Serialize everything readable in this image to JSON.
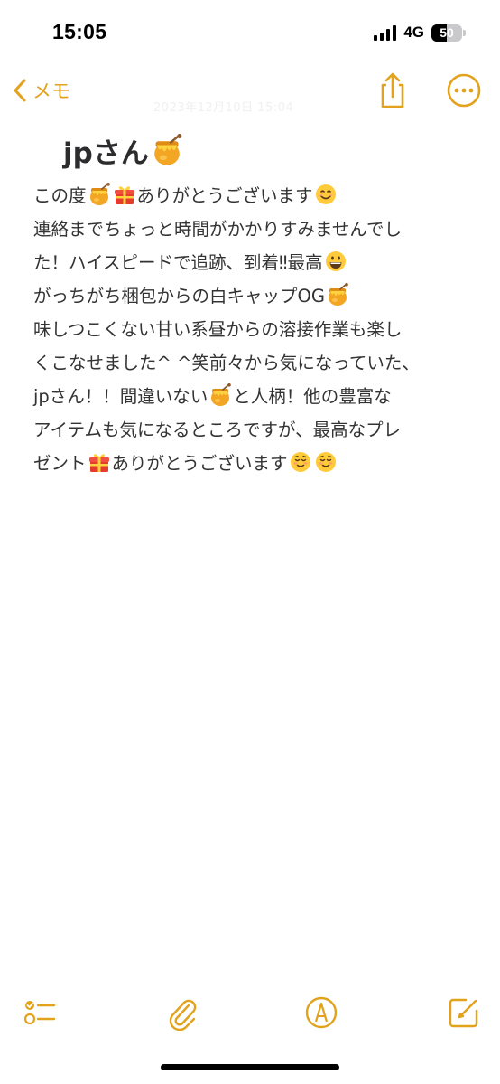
{
  "status_bar": {
    "time": "15:05",
    "network": "4G",
    "battery_level": "50",
    "battery_fraction": 0.5,
    "signal_bars": 4
  },
  "nav": {
    "back_label": "メモ",
    "back_icon": "chevron-left-icon",
    "share_icon": "share-icon",
    "more_icon": "ellipsis-circle-icon",
    "date_text": "2023年12月10日 15:04",
    "accent_color": "#e2a21b"
  },
  "note": {
    "title": "jpさん",
    "title_emoji": "honey-pot",
    "lines": [
      [
        {
          "t": "この度"
        },
        {
          "e": "honey"
        },
        {
          "e": "gift"
        },
        {
          "t": "ありがとうございます"
        },
        {
          "e": "smile"
        }
      ],
      [
        {
          "t": "連絡までちょっと時間がかかりすみませんでし"
        }
      ],
      [
        {
          "t": "た！ハイスピードで追跡、到着‼最高"
        },
        {
          "e": "grin"
        }
      ],
      [
        {
          "t": "がっちがち梱包からの白キャップOG"
        },
        {
          "e": "honey"
        }
      ],
      [
        {
          "t": "味しつこくない甘い系昼からの溶接作業も楽し"
        }
      ],
      [
        {
          "t": "くこなせました^ ^笑前々から気になっていた、"
        }
      ],
      [
        {
          "t": "jpさん！！間違いない"
        },
        {
          "e": "honey"
        },
        {
          "t": "と人柄！他の豊富な"
        }
      ],
      [
        {
          "t": "アイテムも気になるところですが、最高なプレ"
        }
      ],
      [
        {
          "t": "ゼント"
        },
        {
          "e": "gift"
        },
        {
          "t": "ありがとうございます"
        },
        {
          "e": "relieved"
        },
        {
          "e": "relieved"
        }
      ]
    ]
  },
  "toolbar": {
    "items": [
      {
        "name": "checklist-icon"
      },
      {
        "name": "paperclip-icon"
      },
      {
        "name": "markup-pen-icon"
      },
      {
        "name": "compose-icon"
      }
    ]
  }
}
